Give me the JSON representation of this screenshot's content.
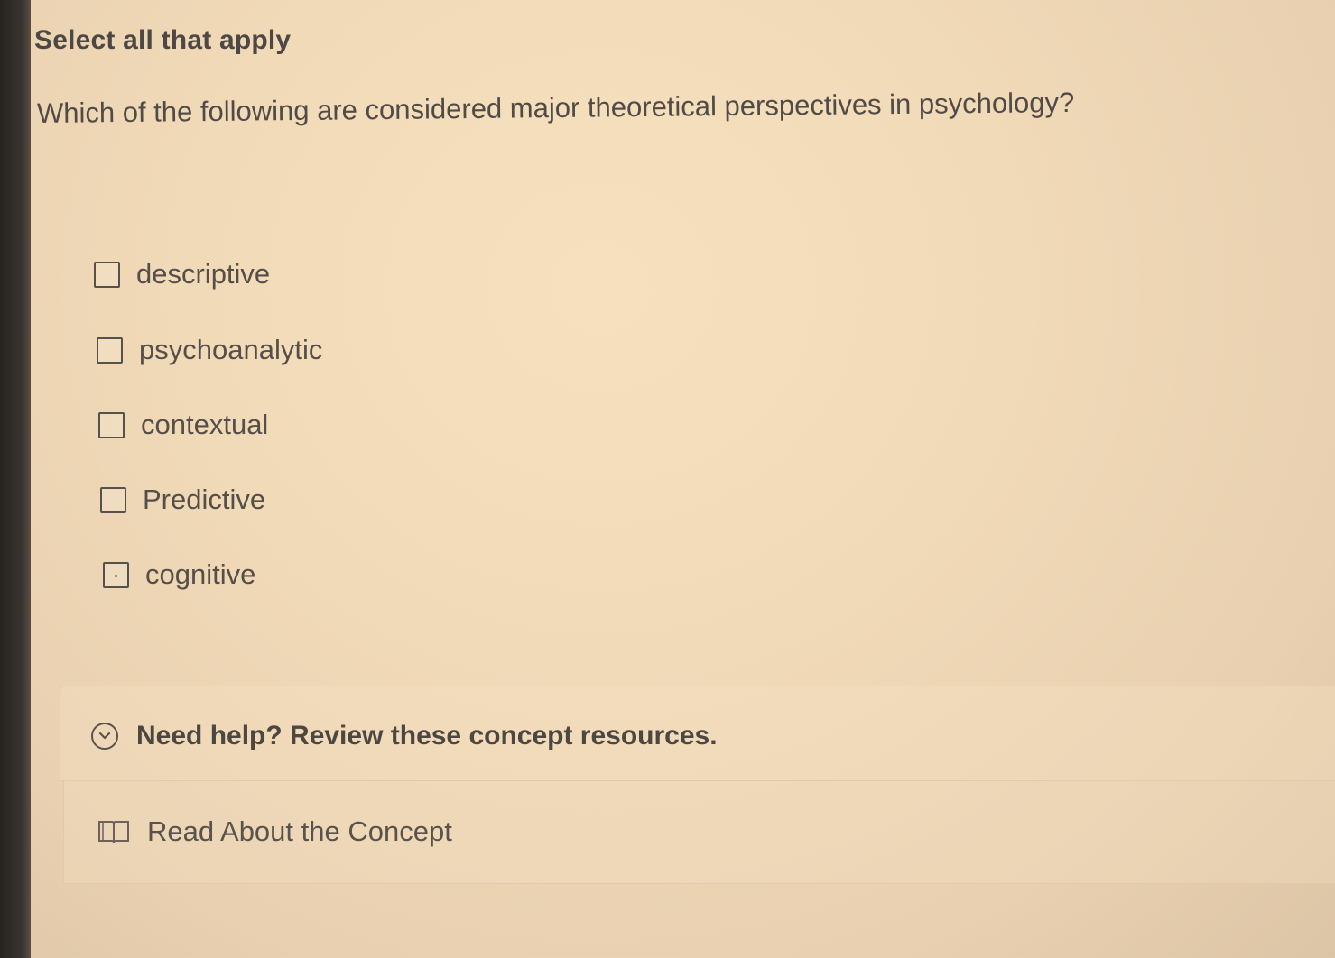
{
  "instruction": "Select all that apply",
  "question": "Which of the following are considered major theoretical perspectives in psychology?",
  "options": [
    {
      "label": "descriptive",
      "checked": false
    },
    {
      "label": "psychoanalytic",
      "checked": false
    },
    {
      "label": "contextual",
      "checked": false
    },
    {
      "label": "Predictive",
      "checked": false
    },
    {
      "label": "cognitive",
      "checked": false
    }
  ],
  "help": {
    "toggle_label": "Need help? Review these concept resources.",
    "toggle_icon": "chevron-down-circle-icon",
    "resources": [
      {
        "label": "Read About the Concept",
        "icon": "book-icon"
      }
    ]
  }
}
